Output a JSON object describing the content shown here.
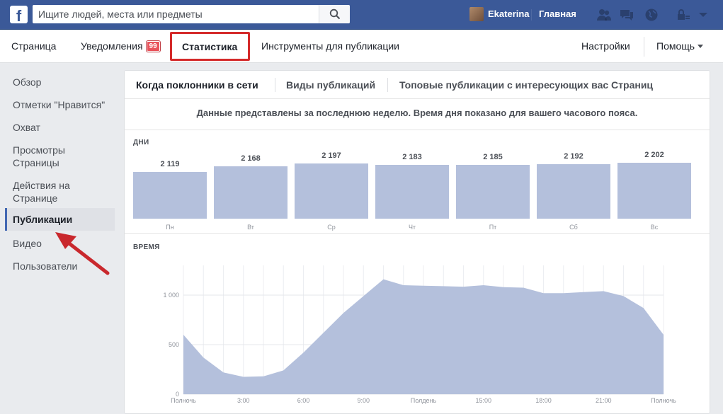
{
  "topbar": {
    "logo_text": "f",
    "search_placeholder": "Ищите людей, места или предметы",
    "user_name": "Ekaterina",
    "home_label": "Главная",
    "icons": [
      "friends-icon",
      "messages-icon",
      "notifications-globe-icon",
      "privacy-lock-icon",
      "account-menu-icon"
    ],
    "brand_color": "#3b5998"
  },
  "pagenav": {
    "items": [
      {
        "label": "Страница"
      },
      {
        "label": "Уведомления",
        "badge": "99"
      },
      {
        "label": "Статистика",
        "active": true
      },
      {
        "label": "Инструменты для публикации"
      }
    ],
    "settings_label": "Настройки",
    "help_label": "Помощь",
    "highlight_color": "#d42a2a"
  },
  "sidebar": {
    "items": [
      {
        "label": "Обзор"
      },
      {
        "label": "Отметки \"Нравится\""
      },
      {
        "label": "Охват"
      },
      {
        "label": "Просмотры Страницы"
      },
      {
        "label": "Действия на Странице"
      },
      {
        "label": "Публикации",
        "active": true
      },
      {
        "label": "Видео"
      },
      {
        "label": "Пользователи"
      }
    ]
  },
  "panel": {
    "tabs": [
      {
        "label": "Когда поклонники в сети",
        "active": true
      },
      {
        "label": "Виды публикаций"
      },
      {
        "label": "Топовые публикации с интересующих вас Страниц"
      }
    ],
    "info_text": "Данные представлены за последнюю неделю. Время дня показано для вашего часового пояса.",
    "days_title": "ДНИ",
    "time_title": "ВРЕМЯ"
  },
  "chart_data": [
    {
      "type": "bar",
      "title": "ДНИ",
      "categories": [
        "Пн",
        "Вт",
        "Ср",
        "Чт",
        "Пт",
        "Сб",
        "Вс"
      ],
      "values": [
        2119,
        2168,
        2197,
        2183,
        2185,
        2192,
        2202
      ],
      "value_labels": [
        "2 119",
        "2 168",
        "2 197",
        "2 183",
        "2 185",
        "2 192",
        "2 202"
      ],
      "color": "#b4c0dc"
    },
    {
      "type": "area",
      "title": "ВРЕМЯ",
      "x_ticks": [
        "Полночь",
        "3:00",
        "6:00",
        "9:00",
        "Полдень",
        "15:00",
        "18:00",
        "21:00",
        "Полночь"
      ],
      "y_ticks": [
        "0",
        "500",
        "1 000"
      ],
      "ylim": [
        0,
        1300
      ],
      "x": [
        0,
        1,
        2,
        3,
        4,
        5,
        6,
        7,
        8,
        9,
        10,
        11,
        12,
        13,
        14,
        15,
        16,
        17,
        18,
        19,
        20,
        21,
        22,
        23,
        24
      ],
      "values": [
        600,
        370,
        220,
        175,
        180,
        240,
        420,
        620,
        820,
        990,
        1160,
        1100,
        1095,
        1090,
        1085,
        1100,
        1080,
        1075,
        1020,
        1020,
        1030,
        1040,
        990,
        870,
        600
      ],
      "grid": true,
      "color": "#b4c0dc"
    }
  ]
}
